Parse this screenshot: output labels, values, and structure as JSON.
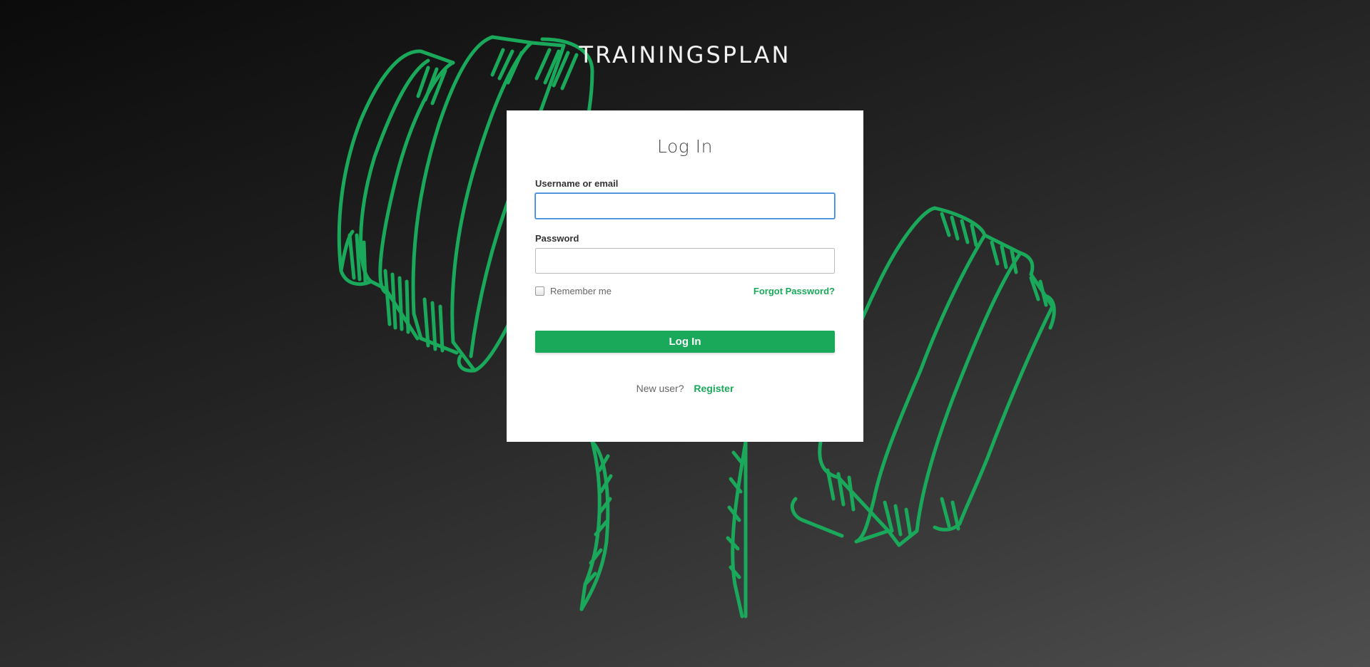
{
  "app": {
    "title": "TRAININGSPLAN"
  },
  "colors": {
    "accent": "#1aa85a",
    "focus_border": "#3b88d8",
    "card_background": "#ffffff",
    "art_stroke": "#1aa85a"
  },
  "background_art": {
    "icon": "dumbbell-sketch-icon"
  },
  "login_form": {
    "heading": "Log In",
    "username_label": "Username or email",
    "username_value": "",
    "username_placeholder": "",
    "password_label": "Password",
    "password_value": "",
    "password_placeholder": "",
    "remember_label": "Remember me",
    "remember_checked": false,
    "forgot_label": "Forgot Password?",
    "submit_label": "Log In",
    "new_user_text": "New user?",
    "register_label": "Register"
  }
}
